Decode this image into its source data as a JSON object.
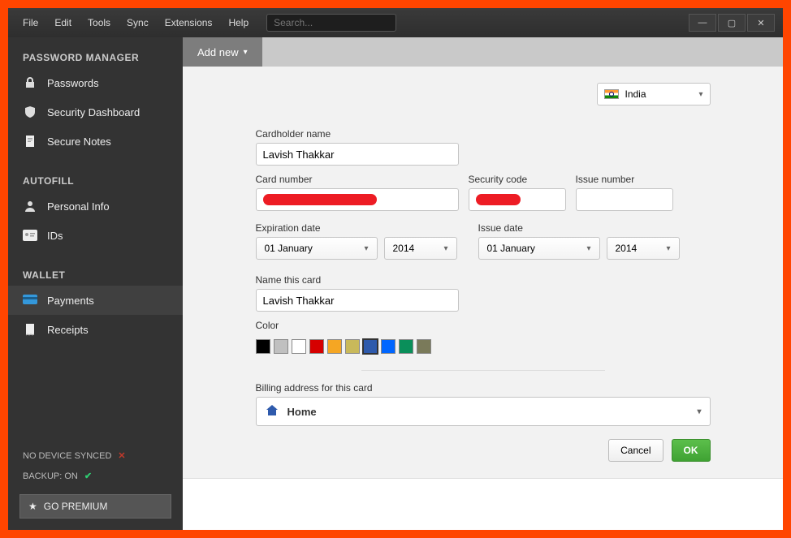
{
  "menubar": {
    "items": [
      "File",
      "Edit",
      "Tools",
      "Sync",
      "Extensions",
      "Help"
    ],
    "search_placeholder": "Search..."
  },
  "sidebar": {
    "sections": [
      {
        "title": "PASSWORD MANAGER",
        "items": [
          {
            "label": "Passwords",
            "icon": "lock"
          },
          {
            "label": "Security Dashboard",
            "icon": "shield"
          },
          {
            "label": "Secure Notes",
            "icon": "note"
          }
        ]
      },
      {
        "title": "AUTOFILL",
        "items": [
          {
            "label": "Personal Info",
            "icon": "person"
          },
          {
            "label": "IDs",
            "icon": "idcard"
          }
        ]
      },
      {
        "title": "WALLET",
        "items": [
          {
            "label": "Payments",
            "icon": "card",
            "active": true
          },
          {
            "label": "Receipts",
            "icon": "receipt"
          }
        ]
      }
    ],
    "status_nosync": "NO DEVICE SYNCED",
    "status_backup": "BACKUP: ON",
    "go_premium": "GO PREMIUM"
  },
  "toolbar": {
    "add_new": "Add new"
  },
  "form": {
    "country": "India",
    "cardholder_label": "Cardholder name",
    "cardholder_value": "Lavish Thakkar",
    "cardnumber_label": "Card number",
    "security_label": "Security code",
    "issuenum_label": "Issue number",
    "expdate_label": "Expiration date",
    "exp_month": "01 January",
    "exp_year": "2014",
    "issuedate_label": "Issue date",
    "issue_month": "01 January",
    "issue_year": "2014",
    "namecard_label": "Name this card",
    "namecard_value": "Lavish Thakkar",
    "color_label": "Color",
    "colors": [
      "#000000",
      "#c0c0c0",
      "#ffffff",
      "#d60000",
      "#f5a623",
      "#c9b95a",
      "#2e5aac",
      "#0066ff",
      "#0a8f5a",
      "#7a7a5a"
    ],
    "selected_color_index": 6,
    "billing_label": "Billing address for this card",
    "billing_value": "Home",
    "cancel": "Cancel",
    "ok": "OK"
  }
}
